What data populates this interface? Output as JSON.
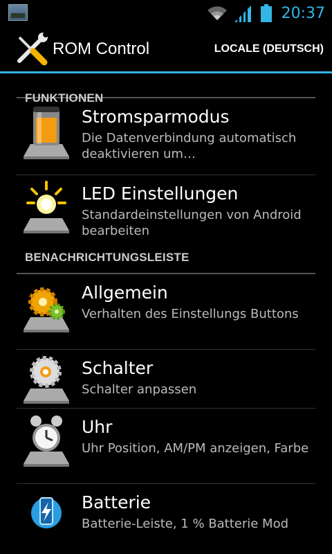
{
  "status_bar": {
    "time": "20:37",
    "accent_color": "#33b5e5",
    "icons": [
      "gallery-notification-icon",
      "wifi-icon",
      "signal-icon",
      "battery-icon"
    ]
  },
  "action_bar": {
    "title": "ROM Control",
    "locale_button": "LOCALE (DEUTSCH)",
    "app_icon": "tools-icon"
  },
  "sections": [
    {
      "header": "FUNKTIONEN",
      "items": [
        {
          "title": "Stromsparmodus",
          "subtitle": "Die Datenverbindung automatisch deaktivieren um…",
          "icon": "battery-jar-icon"
        },
        {
          "title": "LED Einstellungen",
          "subtitle": "Standardeinstellungen von Android bearbeiten",
          "icon": "led-light-icon"
        }
      ]
    },
    {
      "header": "BENACHRICHTUNGSLEISTE",
      "items": [
        {
          "title": "Allgemein",
          "subtitle": "Verhalten des Einstellungs Buttons",
          "icon": "gears-icon"
        },
        {
          "title": "Schalter",
          "subtitle": "Schalter anpassen",
          "icon": "toggle-gear-icon"
        },
        {
          "title": "Uhr",
          "subtitle": "Uhr Position, AM/PM anzeigen, Farbe",
          "icon": "alarm-clock-icon"
        },
        {
          "title": "Batterie",
          "subtitle": "Batterie-Leiste, 1 % Batterie Mod",
          "icon": "battery-charge-icon"
        }
      ]
    }
  ]
}
